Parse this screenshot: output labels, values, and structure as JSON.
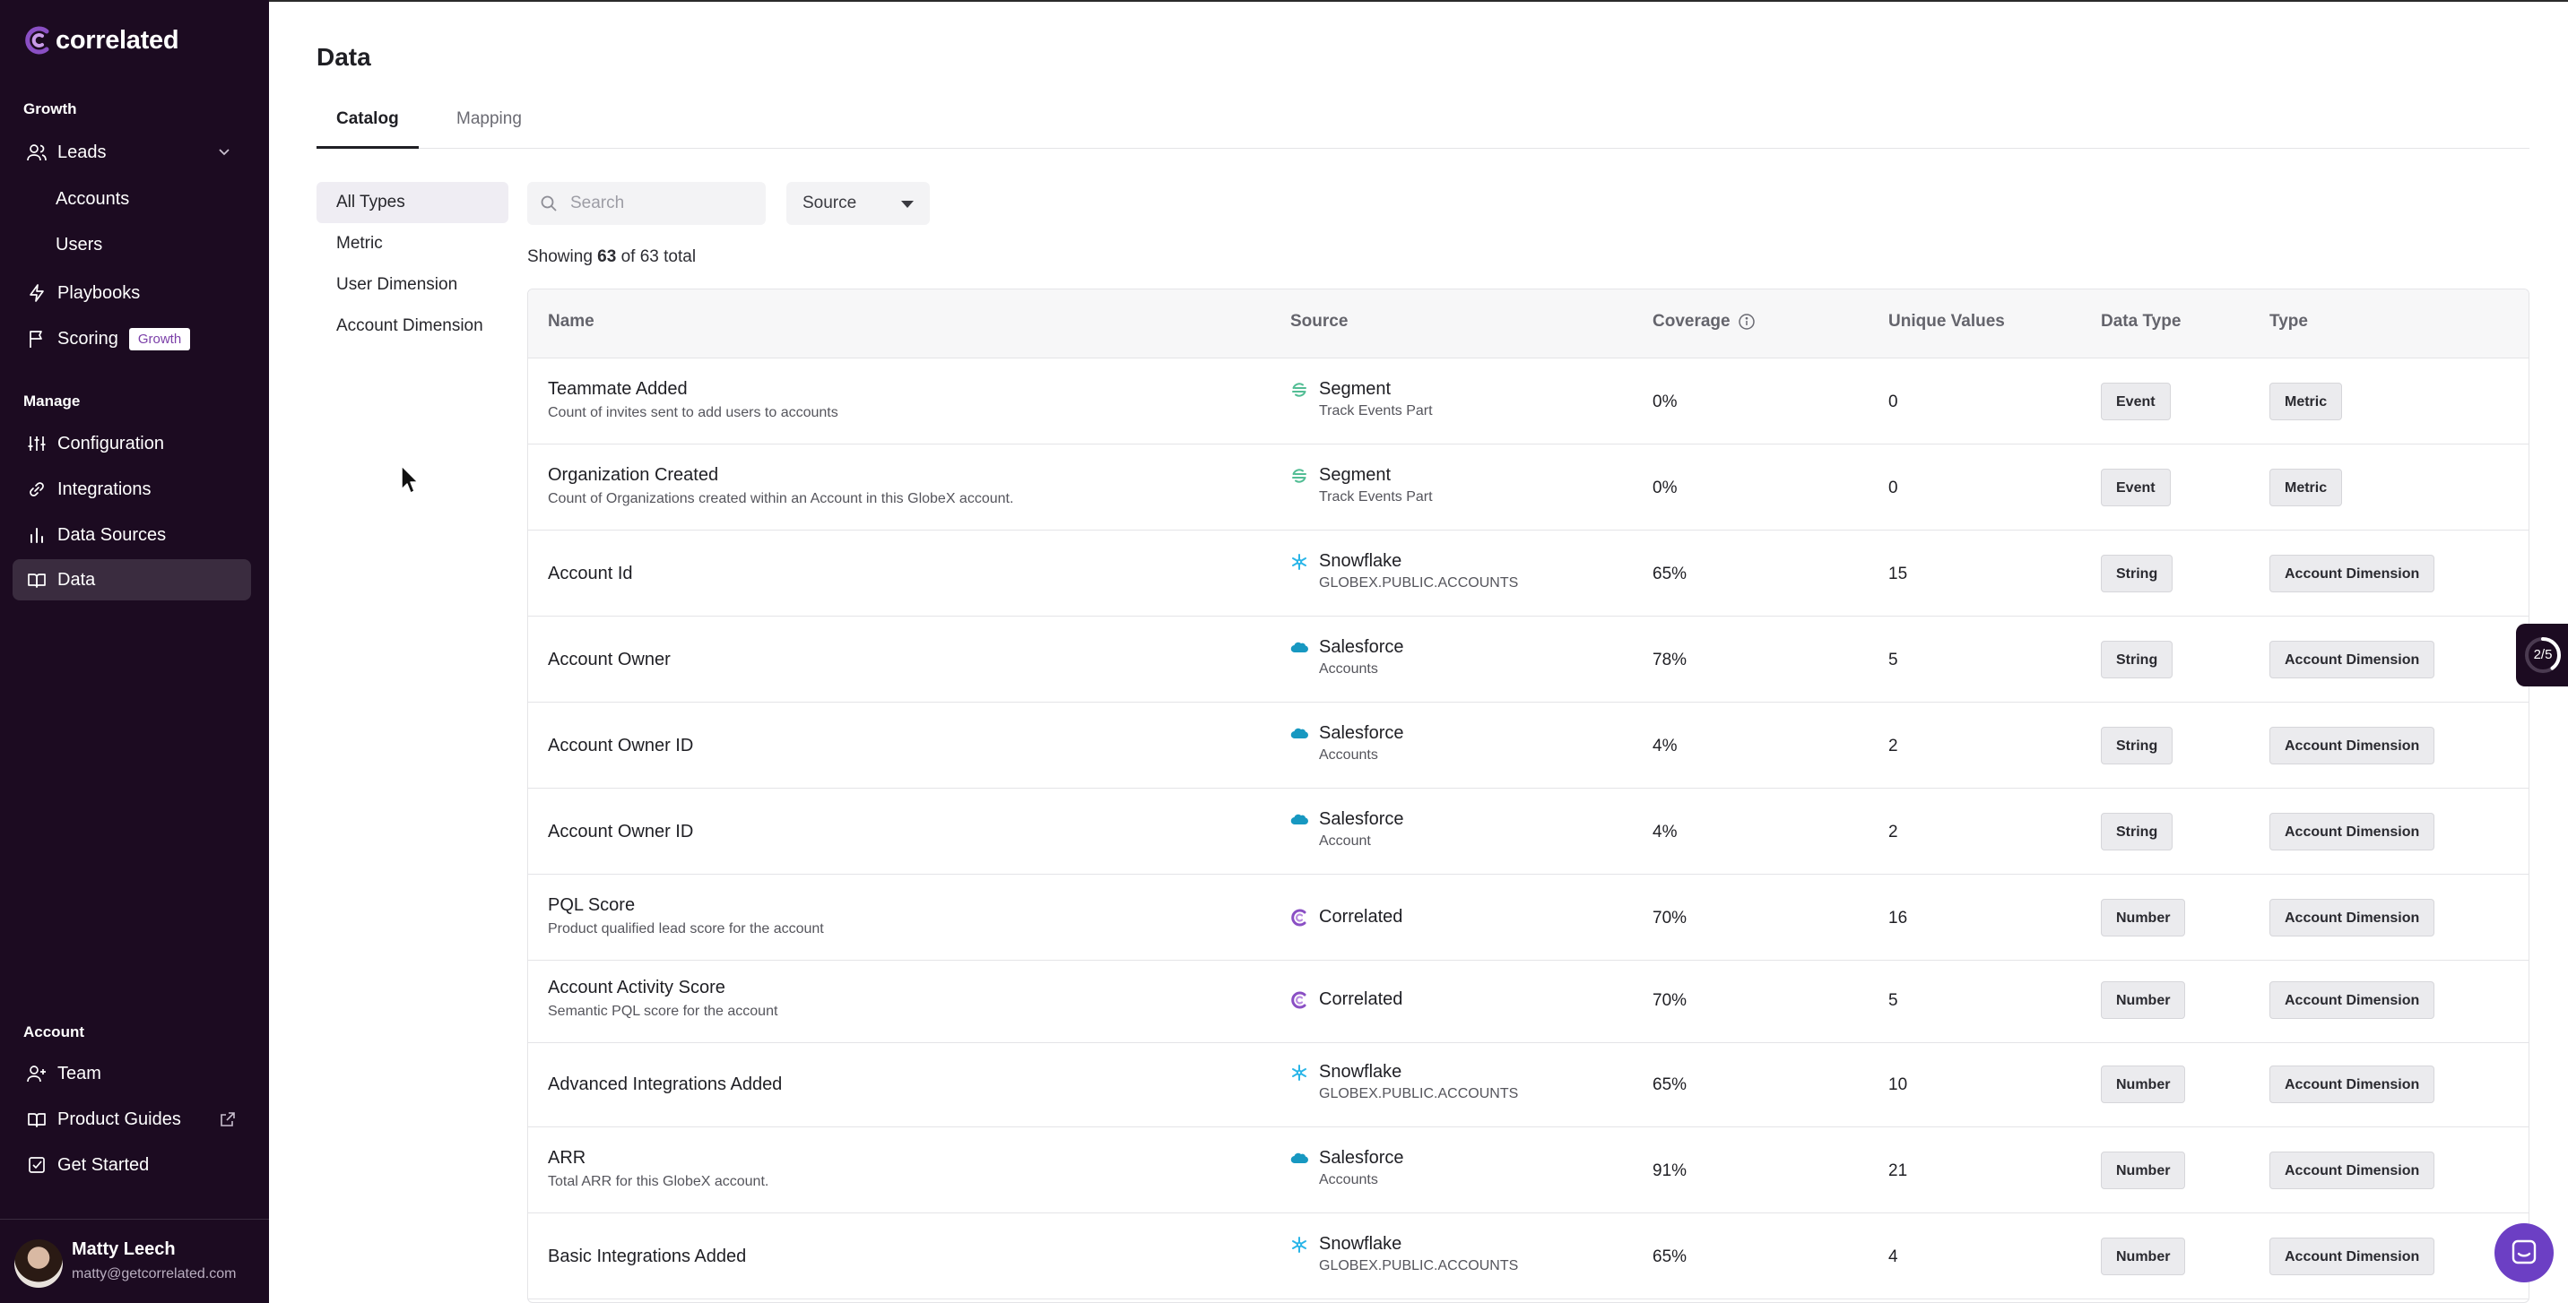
{
  "app": {
    "brand": "correlated"
  },
  "sidebar": {
    "sections": {
      "growth": "Growth",
      "manage": "Manage",
      "account": "Account"
    },
    "leads": "Leads",
    "accounts": "Accounts",
    "users": "Users",
    "playbooks": "Playbooks",
    "scoring": "Scoring",
    "scoring_badge": "Growth",
    "configuration": "Configuration",
    "integrations": "Integrations",
    "data_sources": "Data Sources",
    "data": "Data",
    "team": "Team",
    "product_guides": "Product Guides",
    "get_started": "Get Started",
    "user": {
      "name": "Matty Leech",
      "email": "matty@getcorrelated.com"
    }
  },
  "page": {
    "title": "Data",
    "tabs": [
      "Catalog",
      "Mapping"
    ],
    "filters": [
      "All Types",
      "Metric",
      "User Dimension",
      "Account Dimension"
    ],
    "search_placeholder": "Search",
    "source_label": "Source",
    "showing": {
      "prefix": "Showing",
      "count": "63",
      "middle": "of 63 total"
    }
  },
  "table": {
    "headers": [
      "Name",
      "Source",
      "Coverage",
      "Unique Values",
      "Data Type",
      "Type"
    ],
    "rows": [
      {
        "name": "Teammate Added",
        "desc": "Count of invites sent to add users to accounts",
        "source": "Segment",
        "source_sub": "Track Events Part",
        "source_icon": "segment-icon",
        "coverage": "0%",
        "unique": "0",
        "data_type": "Event",
        "type": "Metric"
      },
      {
        "name": "Organization Created",
        "desc": "Count of Organizations created within an Account in this GlobeX account.",
        "source": "Segment",
        "source_sub": "Track Events Part",
        "source_icon": "segment-icon",
        "coverage": "0%",
        "unique": "0",
        "data_type": "Event",
        "type": "Metric"
      },
      {
        "name": "Account Id",
        "desc": "",
        "source": "Snowflake",
        "source_sub": "GLOBEX.PUBLIC.ACCOUNTS",
        "source_icon": "snowflake-icon",
        "coverage": "65%",
        "unique": "15",
        "data_type": "String",
        "type": "Account Dimension"
      },
      {
        "name": "Account Owner",
        "desc": "",
        "source": "Salesforce",
        "source_sub": "Accounts",
        "source_icon": "salesforce-icon",
        "coverage": "78%",
        "unique": "5",
        "data_type": "String",
        "type": "Account Dimension"
      },
      {
        "name": "Account Owner ID",
        "desc": "",
        "source": "Salesforce",
        "source_sub": "Accounts",
        "source_icon": "salesforce-icon",
        "coverage": "4%",
        "unique": "2",
        "data_type": "String",
        "type": "Account Dimension"
      },
      {
        "name": "Account Owner ID",
        "desc": "",
        "source": "Salesforce",
        "source_sub": "Account",
        "source_icon": "salesforce-icon",
        "coverage": "4%",
        "unique": "2",
        "data_type": "String",
        "type": "Account Dimension"
      },
      {
        "name": "PQL Score",
        "desc": "Product qualified lead score for the account",
        "source": "Correlated",
        "source_sub": "",
        "source_icon": "correlated-icon",
        "coverage": "70%",
        "unique": "16",
        "data_type": "Number",
        "type": "Account Dimension"
      },
      {
        "name": "Account Activity Score",
        "desc": "Semantic PQL score for the account",
        "source": "Correlated",
        "source_sub": "",
        "source_icon": "correlated-icon",
        "coverage": "70%",
        "unique": "5",
        "data_type": "Number",
        "type": "Account Dimension"
      },
      {
        "name": "Advanced Integrations Added",
        "desc": "",
        "source": "Snowflake",
        "source_sub": "GLOBEX.PUBLIC.ACCOUNTS",
        "source_icon": "snowflake-icon",
        "coverage": "65%",
        "unique": "10",
        "data_type": "Number",
        "type": "Account Dimension"
      },
      {
        "name": "ARR",
        "desc": "Total ARR for this GlobeX account.",
        "source": "Salesforce",
        "source_sub": "Accounts",
        "source_icon": "salesforce-icon",
        "coverage": "91%",
        "unique": "21",
        "data_type": "Number",
        "type": "Account Dimension"
      },
      {
        "name": "Basic Integrations Added",
        "desc": "",
        "source": "Snowflake",
        "source_sub": "GLOBEX.PUBLIC.ACCOUNTS",
        "source_icon": "snowflake-icon",
        "coverage": "65%",
        "unique": "4",
        "data_type": "Number",
        "type": "Account Dimension"
      }
    ]
  },
  "widgets": {
    "progress": "2/5",
    "progress_fraction": 0.4
  },
  "colors": {
    "sidebar_bg": "#1c0b21",
    "brand_purple": "#7b3fa8",
    "chat_button": "#6c3fc4"
  }
}
